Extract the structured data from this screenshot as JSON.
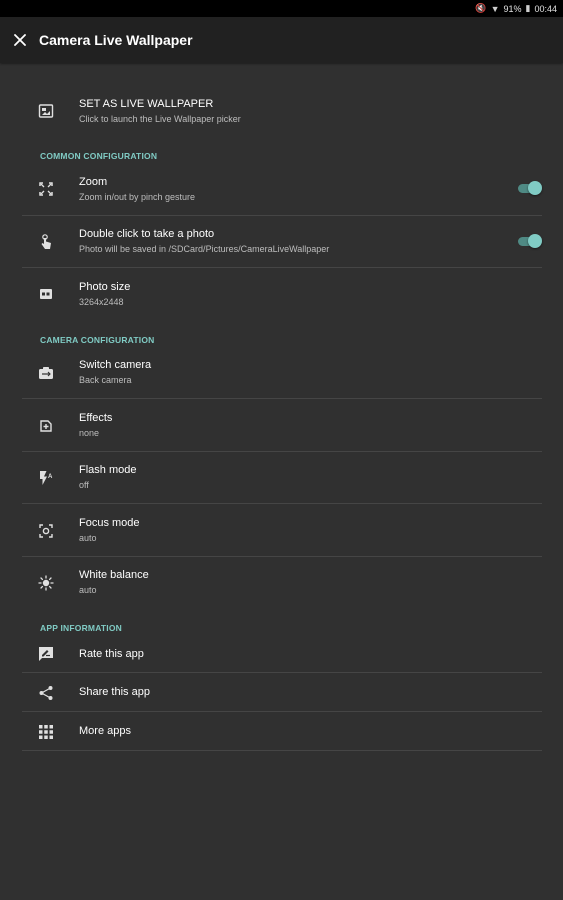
{
  "status_bar": {
    "battery": "91%",
    "time": "00:44"
  },
  "toolbar": {
    "title": "Camera Live Wallpaper"
  },
  "set_wallpaper": {
    "title": "SET AS LIVE WALLPAPER",
    "subtitle": "Click to launch the Live Wallpaper picker"
  },
  "sections": {
    "common": "COMMON CONFIGURATION",
    "camera": "CAMERA CONFIGURATION",
    "app_info": "APP INFORMATION"
  },
  "common": {
    "zoom": {
      "title": "Zoom",
      "subtitle": "Zoom in/out by pinch gesture",
      "enabled": true
    },
    "double_click": {
      "title": "Double click to take a photo",
      "subtitle": "Photo will be saved in /SDCard/Pictures/CameraLiveWallpaper",
      "enabled": true
    },
    "photo_size": {
      "title": "Photo size",
      "subtitle": "3264x2448"
    }
  },
  "camera": {
    "switch_camera": {
      "title": "Switch camera",
      "subtitle": "Back camera"
    },
    "effects": {
      "title": "Effects",
      "subtitle": "none"
    },
    "flash_mode": {
      "title": "Flash mode",
      "subtitle": "off"
    },
    "focus_mode": {
      "title": "Focus mode",
      "subtitle": "auto"
    },
    "white_balance": {
      "title": "White balance",
      "subtitle": "auto"
    }
  },
  "app_info": {
    "rate": "Rate this app",
    "share": "Share this app",
    "more": "More apps"
  },
  "colors": {
    "background": "#303030",
    "toolbar": "#212121",
    "accent": "#80cbc4",
    "divider": "#454545"
  }
}
